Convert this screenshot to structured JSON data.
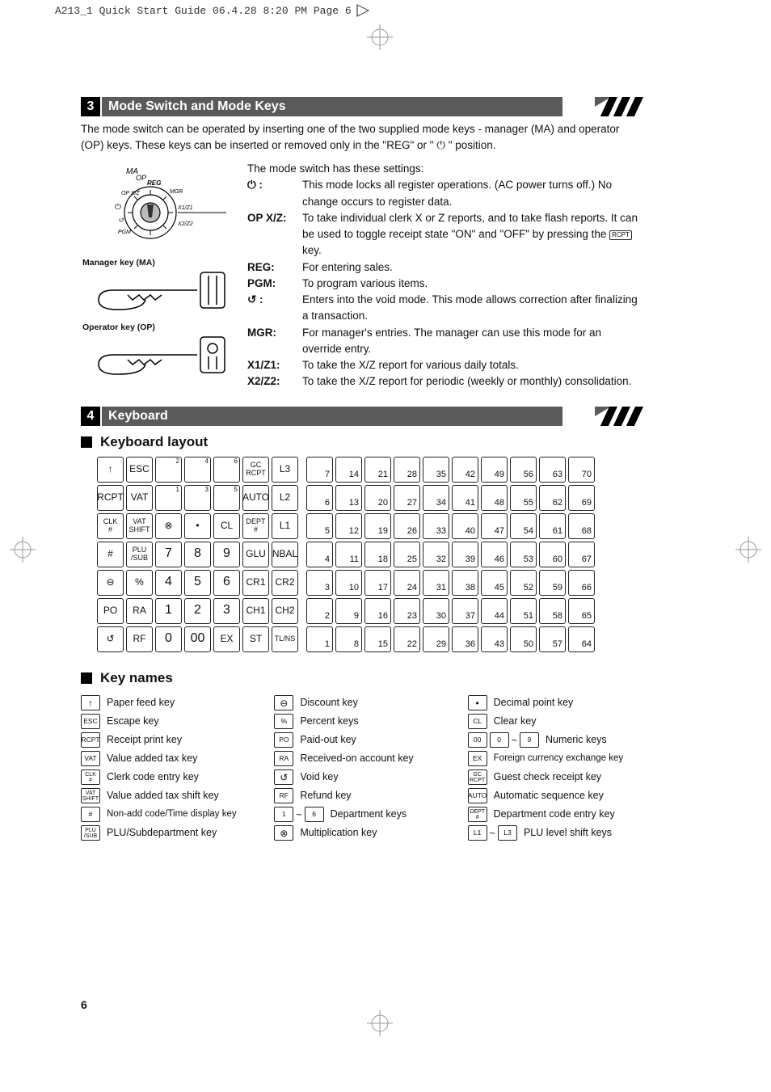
{
  "slug": "A213_1 Quick Start Guide  06.4.28 8:20 PM  Page 6",
  "page_number": "6",
  "section3": {
    "num": "3",
    "title": "Mode Switch and Mode Keys",
    "intro": "The mode switch can be operated by inserting one of the two supplied mode keys - manager (MA) and operator (OP) keys.  These keys can be inserted or removed only in the \"REG\" or \" ⏻ \" position.",
    "dial_labels": {
      "ma": "MA",
      "op": "OP",
      "reg": "REG",
      "opxz": "OP X/Z",
      "mgr": "MGR",
      "x1z1": "X1/Z1",
      "x2z2": "X2/Z2",
      "pgm": "PGM",
      "void_sym": "↺"
    },
    "key_ma": "Manager key (MA)",
    "key_op": "Operator key (OP)",
    "settings_title": "The mode switch has these settings:",
    "rows": [
      {
        "label": "⏻ :",
        "text": "This mode locks all register operations. (AC power turns off.) No change occurs to register data."
      },
      {
        "label": "OP X/Z:",
        "text": "To take individual clerk X or Z reports, and to take flash reports. It can be used to toggle receipt state \"ON\" and \"OFF\" by pressing the ",
        "text2": " key."
      },
      {
        "label": "REG:",
        "text": "For entering sales."
      },
      {
        "label": "PGM:",
        "text": "To program various items."
      },
      {
        "label": "↺   :",
        "text": "Enters into the void mode.  This mode allows correction after finalizing a transaction."
      },
      {
        "label": "MGR:",
        "text": "For manager's entries.  The manager can use this mode for an override entry."
      },
      {
        "label": "X1/Z1:",
        "text": "To take the X/Z report for various daily totals."
      },
      {
        "label": "X2/Z2:",
        "text": "To take the X/Z report for periodic (weekly or monthly) consolidation."
      }
    ],
    "rcpt": "RCPT"
  },
  "section4": {
    "num": "4",
    "title": "Keyboard",
    "sub1": "Keyboard layout",
    "sub2": "Key names",
    "leftKeys": [
      [
        "↑",
        "ESC",
        "2|c",
        "4|c",
        "6|c",
        "GC\nRCPT",
        "L3",
        ""
      ],
      [
        "RCPT",
        "VAT",
        "1|c",
        "3|c",
        "5|c",
        "AUTO",
        "L2",
        ""
      ],
      [
        "CLK\n#",
        "VAT\nSHIFT",
        "⊗",
        "•",
        "CL",
        "DEPT\n#",
        "L1",
        ""
      ],
      [
        "#",
        "PLU\n/SUB",
        "7",
        "8",
        "9",
        "GLU",
        "NBAL",
        ""
      ],
      [
        "⊖",
        "%",
        "4",
        "5",
        "6",
        "CR1",
        "CR2",
        ""
      ],
      [
        "PO",
        "RA",
        "1",
        "2",
        "3",
        "CH1",
        "CH2",
        ""
      ],
      [
        "↺",
        "RF",
        "0",
        "00",
        "EX",
        "ST",
        "TL/NS",
        ""
      ]
    ],
    "deptNums": [
      [
        7,
        14,
        21,
        28,
        35,
        42,
        49,
        56,
        63,
        70
      ],
      [
        6,
        13,
        20,
        27,
        34,
        41,
        48,
        55,
        62,
        69
      ],
      [
        5,
        12,
        19,
        26,
        33,
        40,
        47,
        54,
        61,
        68
      ],
      [
        4,
        11,
        18,
        25,
        32,
        39,
        46,
        53,
        60,
        67
      ],
      [
        3,
        10,
        17,
        24,
        31,
        38,
        45,
        52,
        59,
        66
      ],
      [
        2,
        9,
        16,
        23,
        30,
        37,
        44,
        51,
        58,
        65
      ],
      [
        1,
        8,
        15,
        22,
        29,
        36,
        43,
        50,
        57,
        64
      ]
    ],
    "keyNames": {
      "col1": [
        {
          "cap": "↑",
          "sym": true,
          "desc": "Paper feed key"
        },
        {
          "cap": "ESC",
          "desc": "Escape key"
        },
        {
          "cap": "RCPT",
          "desc": "Receipt print key"
        },
        {
          "cap": "VAT",
          "desc": "Value added tax key"
        },
        {
          "cap": "CLK\n#",
          "desc": "Clerk code entry key"
        },
        {
          "cap": "VAT\nSHIFT",
          "desc": "Value added tax shift key"
        },
        {
          "cap": "#",
          "desc": "Non-add code/Time display key",
          "two": true
        },
        {
          "cap": "PLU\n/SUB",
          "desc": "PLU/Subdepartment key"
        }
      ],
      "col2": [
        {
          "cap": "⊖",
          "sym": true,
          "desc": "Discount key"
        },
        {
          "cap": "%",
          "desc": "Percent keys"
        },
        {
          "cap": "PO",
          "desc": "Paid-out key"
        },
        {
          "cap": "RA",
          "desc": "Received-on account key"
        },
        {
          "cap": "↺",
          "sym": true,
          "desc": "Void key"
        },
        {
          "cap": "RF",
          "desc": "Refund key"
        },
        {
          "range": [
            "1",
            "6"
          ],
          "desc": "Department keys"
        },
        {
          "cap": "⊗",
          "sym": true,
          "desc": "Multiplication key"
        }
      ],
      "col3": [
        {
          "cap": "•",
          "sym": true,
          "desc": "Decimal point key"
        },
        {
          "cap": "CL",
          "desc": "Clear key"
        },
        {
          "range": [
            "00",
            "0",
            "9"
          ],
          "triple": true,
          "desc": "Numeric keys"
        },
        {
          "cap": "EX",
          "desc": "Foreign currency exchange key",
          "two": true
        },
        {
          "cap": "GC\nRCPT",
          "desc": "Guest check receipt key"
        },
        {
          "cap": "AUTO",
          "desc": "Automatic sequence key"
        },
        {
          "cap": "DEPT\n#",
          "desc": "Department code entry key"
        },
        {
          "range": [
            "L1",
            "L3"
          ],
          "desc": "PLU level shift keys"
        }
      ]
    }
  }
}
